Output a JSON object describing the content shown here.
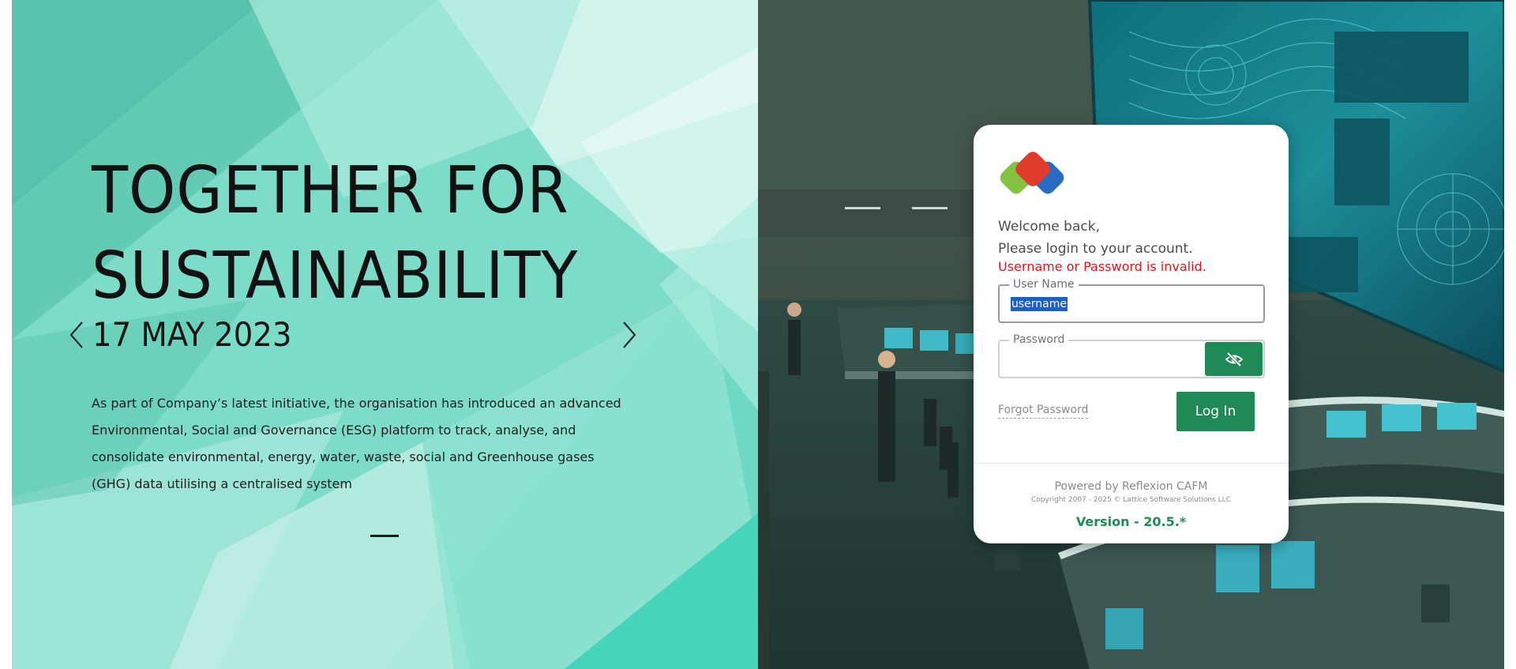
{
  "promo": {
    "title": "TOGETHER FOR\nSUSTAINABILITY",
    "date": "17 MAY 2023",
    "text": "As part of Company’s latest initiative, the organisation has introduced an advanced Environmental, Social and Governance (ESG) platform to track, analyse, and consolidate environmental, energy, water, waste, social and Greenhouse gases (GHG) data utilising a centralised system",
    "prev_icon": "chevron-left-icon",
    "next_icon": "chevron-right-icon"
  },
  "login": {
    "logo_icon": "app-logo",
    "welcome_line1": "Welcome back,",
    "welcome_line2": "Please login to your account.",
    "error": "Username or Password is invalid.",
    "username": {
      "label": "User Name",
      "value": "username"
    },
    "password": {
      "label": "Password",
      "value": "",
      "toggle_icon": "eye-slash-icon"
    },
    "forgot_label": "Forgot Password",
    "login_label": "Log In",
    "powered_by": "Powered by Reflexion CAFM",
    "copyright": "Copyright 2007 - 2025 © Lattice Software Solutions LLC",
    "version": "Version - 20.5.*"
  },
  "colors": {
    "accent": "#1f8a55",
    "error": "#e0161b",
    "promo_bg": "#6fd9c3",
    "selection": "#1d5fc5"
  }
}
